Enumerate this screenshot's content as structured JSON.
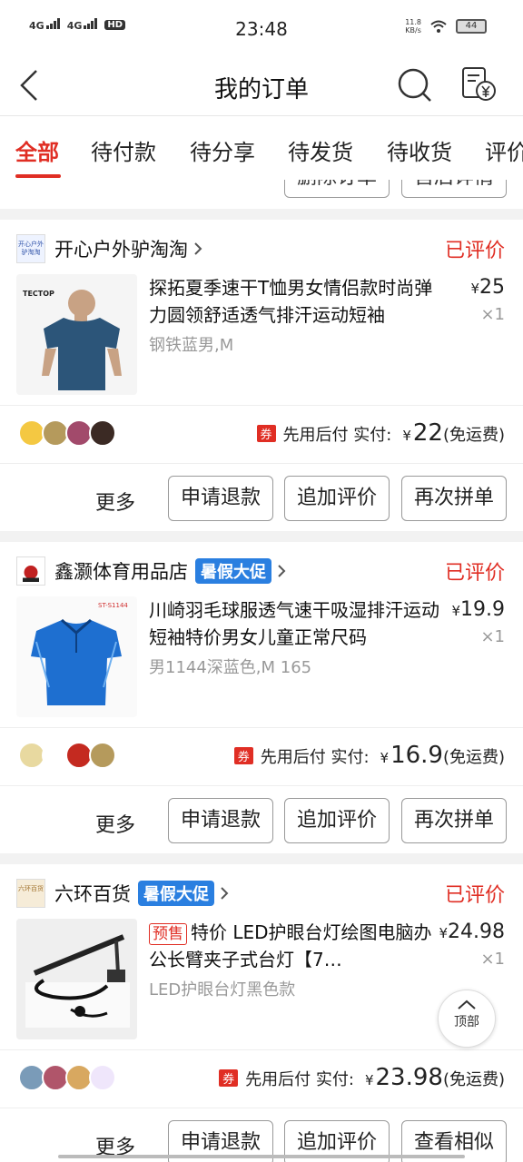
{
  "status_bar": {
    "sig1": "4G",
    "sig2": "4G",
    "hd": "HD",
    "time": "23:48",
    "speed_value": "11.8",
    "speed_unit": "KB/s",
    "battery": "44"
  },
  "nav": {
    "title": "我的订单"
  },
  "tabs": [
    "全部",
    "待付款",
    "待分享",
    "待发货",
    "待收货",
    "评价"
  ],
  "prev_card": {
    "btn1": "删除订单",
    "btn2": "售后详情"
  },
  "orders": [
    {
      "shop_logo": "开心户外驴淘淘",
      "shop": "开心户外驴淘淘",
      "status": "已评价",
      "title": "探拓夏季速干T恤男女情侣款时尚弹力圆领舒适透气排汗运动短袖",
      "spec": "钢铁蓝男,M",
      "unit_price": "25",
      "qty": "×1",
      "coupon": "券",
      "pay_label": "先用后付  实付:",
      "paid": "22",
      "shipping": "(免运费)",
      "more": "更多",
      "buttons": [
        "申请退款",
        "追加评价",
        "再次拼单"
      ]
    },
    {
      "shop": "鑫灏体育用品店",
      "promo": "暑假大促",
      "status": "已评价",
      "thumb_label": "ST-S1144",
      "title": "川崎羽毛球服透气速干吸湿排汗运动短袖特价男女儿童正常尺码",
      "spec": "男1144深蓝色,M 165",
      "unit_price": "19.9",
      "qty": "×1",
      "coupon": "券",
      "pay_label": "先用后付  实付:",
      "paid": "16.9",
      "shipping": "(免运费)",
      "more": "更多",
      "buttons": [
        "申请退款",
        "追加评价",
        "再次拼单"
      ]
    },
    {
      "shop_logo": "六环百货",
      "shop": "六环百货",
      "promo": "暑假大促",
      "status": "已评价",
      "tag": "预售",
      "title": "特价 LED护眼台灯绘图电脑办公长臂夹子式台灯【7…",
      "spec": "LED护眼台灯黑色款",
      "unit_price": "24.98",
      "qty": "×1",
      "coupon": "券",
      "pay_label": "先用后付  实付:",
      "paid": "23.98",
      "shipping": "(免运费)",
      "more": "更多",
      "buttons": [
        "申请退款",
        "追加评价",
        "查看相似"
      ]
    }
  ],
  "currency": "¥",
  "top_button": "顶部",
  "colors": {
    "accent": "#e02e24",
    "promo": "#2a7fe0"
  }
}
